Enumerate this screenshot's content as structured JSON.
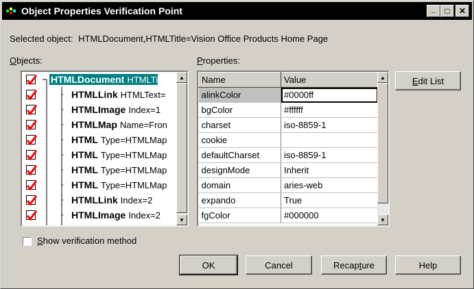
{
  "window": {
    "title": "Object Properties Verification Point",
    "minimize_glyph": "_",
    "maximize_glyph": "□",
    "close_glyph": "✕"
  },
  "selected_object": {
    "label": "Selected object:",
    "value": "HTMLDocument,HTMLTitle=Vision Office Products Home Page"
  },
  "objects": {
    "label_underlined": "O",
    "label_rest": "bjects:",
    "items": [
      {
        "bold": "HTMLDocument",
        "rest": "HTMLTi",
        "checked": true,
        "selected": true
      },
      {
        "bold": "HTMLLink",
        "rest": "HTMLText=",
        "checked": true
      },
      {
        "bold": "HTMLImage",
        "rest": "Index=1",
        "checked": true
      },
      {
        "bold": "HTMLMap",
        "rest": "Name=Fron",
        "checked": true
      },
      {
        "bold": "HTML",
        "rest": "Type=HTMLMap",
        "checked": true
      },
      {
        "bold": "HTML",
        "rest": "Type=HTMLMap",
        "checked": true
      },
      {
        "bold": "HTML",
        "rest": "Type=HTMLMap",
        "checked": true
      },
      {
        "bold": "HTML",
        "rest": "Type=HTMLMap",
        "checked": true
      },
      {
        "bold": "HTMLLink",
        "rest": "Index=2",
        "checked": true
      },
      {
        "bold": "HTMLImage",
        "rest": "Index=2",
        "checked": true
      }
    ]
  },
  "properties": {
    "label_underlined": "P",
    "label_rest": "roperties:",
    "columns": [
      "Name",
      "Value"
    ],
    "rows": [
      {
        "name": "alinkColor",
        "value": "#0000ff"
      },
      {
        "name": "bgColor",
        "value": "#ffffff"
      },
      {
        "name": "charset",
        "value": "iso-8859-1"
      },
      {
        "name": "cookie",
        "value": ""
      },
      {
        "name": "defaultCharset",
        "value": "iso-8859-1"
      },
      {
        "name": "designMode",
        "value": "Inherit"
      },
      {
        "name": "domain",
        "value": "aries-web"
      },
      {
        "name": "expando",
        "value": "True"
      },
      {
        "name": "fgColor",
        "value": "#000000"
      }
    ]
  },
  "buttons": {
    "edit_list_u": "E",
    "edit_list_rest": "dit List",
    "ok": "OK",
    "cancel": "Cancel",
    "recapture_pre": "Recap",
    "recapture_u": "t",
    "recapture_post": "ure",
    "help": "Help"
  },
  "verification": {
    "label_u": "S",
    "label_rest": "how verification method",
    "checked": false
  },
  "colors": {
    "titlebar": "#000000",
    "selection": "#008080",
    "checkmark": "#ff0000",
    "face": "#d4d0c8"
  }
}
